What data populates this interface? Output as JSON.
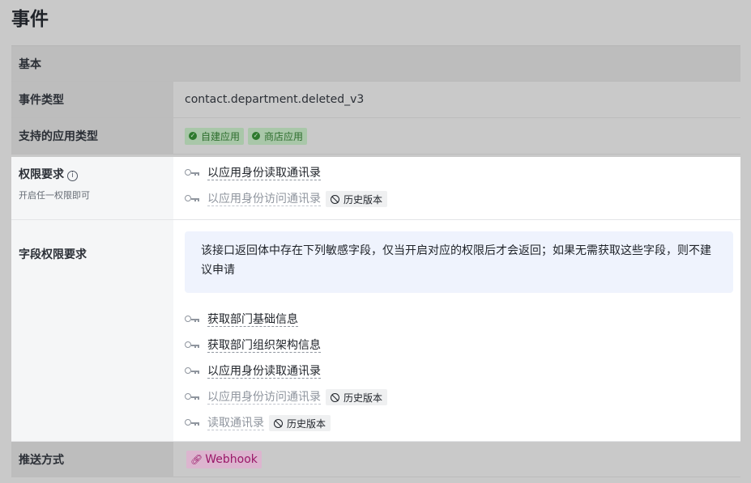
{
  "page": {
    "title": "事件"
  },
  "sections": {
    "basic": "基本"
  },
  "event_type": {
    "label": "事件类型",
    "value": "contact.department.deleted_v3"
  },
  "app_types": {
    "label": "支持的应用类型",
    "tags": [
      "自建应用",
      "商店应用"
    ]
  },
  "permissions": {
    "label": "权限要求",
    "info_icon": "ⓘ",
    "sub": "开启任一权限即可",
    "scopes": [
      {
        "name": "以应用身份读取通讯录",
        "deprecated": false
      },
      {
        "name": "以应用身份访问通讯录",
        "deprecated": true,
        "tag": "历史版本"
      }
    ]
  },
  "field_permissions": {
    "label": "字段权限要求",
    "notice": "该接口返回体中存在下列敏感字段，仅当开启对应的权限后才会返回；如果无需获取这些字段，则不建议申请",
    "scopes": [
      {
        "name": "获取部门基础信息",
        "deprecated": false
      },
      {
        "name": "获取部门组织架构信息",
        "deprecated": false
      },
      {
        "name": "以应用身份读取通讯录",
        "deprecated": false
      },
      {
        "name": "以应用身份访问通讯录",
        "deprecated": true,
        "tag": "历史版本"
      },
      {
        "name": "读取通讯录",
        "deprecated": true,
        "tag": "历史版本"
      }
    ]
  },
  "push": {
    "label": "推送方式",
    "value": "Webhook"
  },
  "icons": {
    "key": "key-icon",
    "check": "check-circle-icon",
    "ban": "ban-icon",
    "link": "link-icon",
    "info": "info-icon"
  },
  "colors": {
    "accent_green": "#2d6e2d",
    "webhook": "#9a1768",
    "notice_bg": "#eff3fd"
  }
}
